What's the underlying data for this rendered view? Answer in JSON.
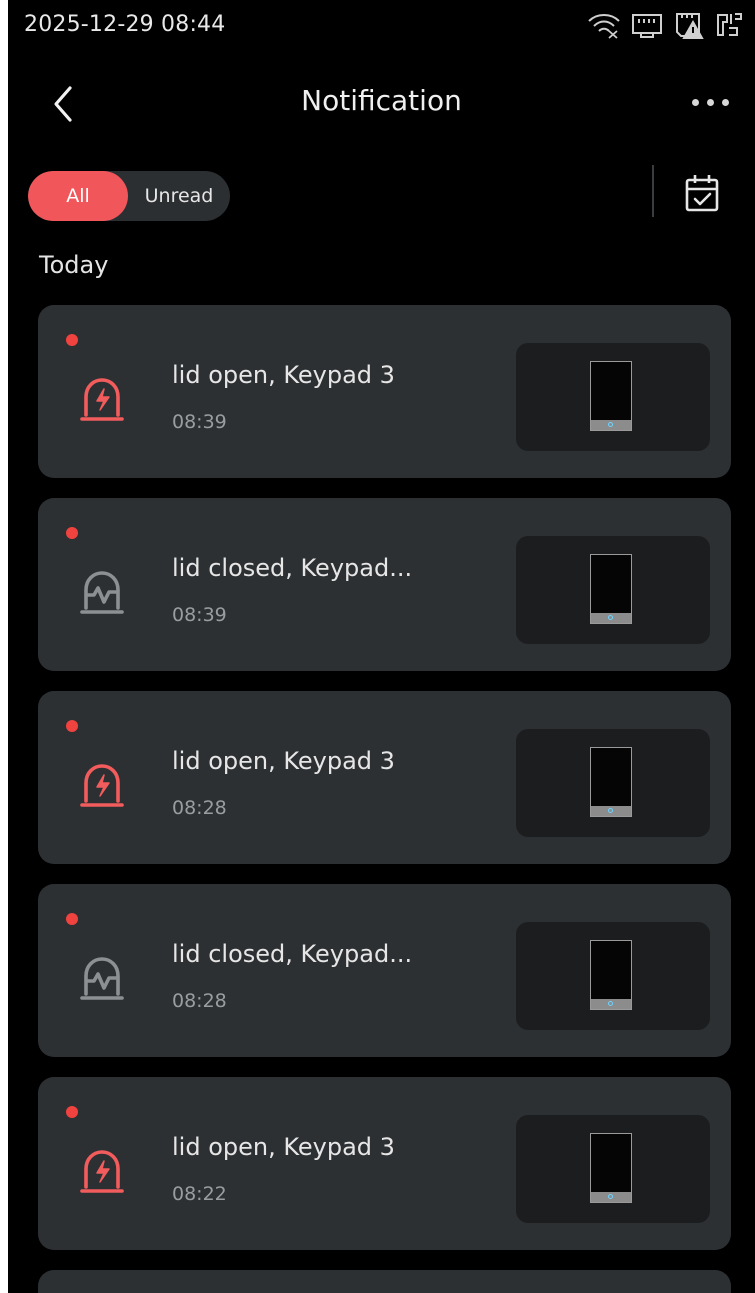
{
  "status_bar": {
    "datetime": "2025-12-29 08:44",
    "icons": [
      "wifi-off-icon",
      "ethernet-icon",
      "sd-card-warning-icon",
      "ip-icon"
    ]
  },
  "header": {
    "title": "Notification",
    "back_icon": "chevron-left-icon",
    "more_icon": "more-horizontal-icon"
  },
  "filter": {
    "tabs": [
      {
        "label": "All",
        "active": true
      },
      {
        "label": "Unread",
        "active": false
      }
    ],
    "calendar_icon": "calendar-check-icon"
  },
  "section": {
    "title": "Today"
  },
  "colors": {
    "accent": "#f0565a",
    "unread_dot": "#f0433f",
    "alarm_red": "#f25c5c",
    "restore_grey": "#8d9093",
    "card_bg": "#2d3033"
  },
  "notifications": [
    {
      "title": "lid open, Keypad 3",
      "time": "08:39",
      "type": "alarm",
      "icon": "tamper-alarm-icon",
      "unread": true
    },
    {
      "title": "lid closed, Keypad...",
      "time": "08:39",
      "type": "restore",
      "icon": "tamper-restore-icon",
      "unread": true
    },
    {
      "title": "lid open, Keypad 3",
      "time": "08:28",
      "type": "alarm",
      "icon": "tamper-alarm-icon",
      "unread": true
    },
    {
      "title": "lid closed, Keypad...",
      "time": "08:28",
      "type": "restore",
      "icon": "tamper-restore-icon",
      "unread": true
    },
    {
      "title": "lid open, Keypad 3",
      "time": "08:22",
      "type": "alarm",
      "icon": "tamper-alarm-icon",
      "unread": true
    }
  ]
}
